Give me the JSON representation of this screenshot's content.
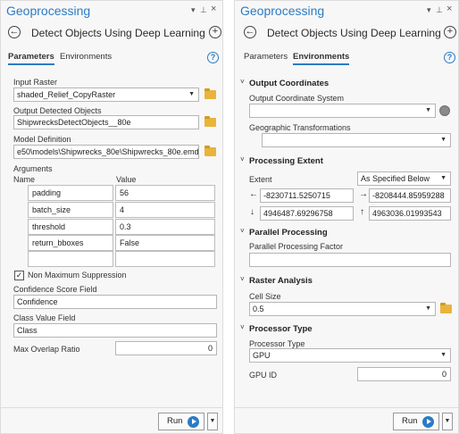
{
  "left": {
    "title": "Geoprocessing",
    "tool_name": "Detect Objects Using Deep Learning",
    "tabs": [
      "Parameters",
      "Environments"
    ],
    "input_raster_label": "Input Raster",
    "input_raster_value": "shaded_Relief_CopyRaster",
    "output_label": "Output Detected Objects",
    "output_value": "ShipwrecksDetectObjects__80e",
    "model_label": "Model Definition",
    "model_value": "e50\\models\\Shipwrecks_80e\\Shipwrecks_80e.emd",
    "arguments_label": "Arguments",
    "arg_col_name": "Name",
    "arg_col_value": "Value",
    "arguments": [
      {
        "name": "padding",
        "value": "56"
      },
      {
        "name": "batch_size",
        "value": "4"
      },
      {
        "name": "threshold",
        "value": "0.3"
      },
      {
        "name": "return_bboxes",
        "value": "False"
      }
    ],
    "nms_label": "Non Maximum Suppression",
    "nms_checked": true,
    "conf_label": "Confidence Score Field",
    "conf_value": "Confidence",
    "class_label": "Class Value Field",
    "class_value": "Class",
    "overlap_label": "Max Overlap Ratio",
    "overlap_value": "0",
    "run_label": "Run"
  },
  "right": {
    "title": "Geoprocessing",
    "tool_name": "Detect Objects Using Deep Learning",
    "tabs": [
      "Parameters",
      "Environments"
    ],
    "output_coords_section": "Output Coordinates",
    "ocs_label": "Output Coordinate System",
    "ocs_value": "",
    "geo_trans_label": "Geographic Transformations",
    "geo_trans_value": "",
    "processing_extent_section": "Processing Extent",
    "extent_label": "Extent",
    "extent_value": "As Specified Below",
    "extent_left": "-8230711.5250715",
    "extent_right": "-8208444.85959288",
    "extent_bottom": "4946487.69296758",
    "extent_top": "4963036.01993543",
    "parallel_section": "Parallel Processing",
    "ppf_label": "Parallel Processing Factor",
    "ppf_value": "",
    "raster_section": "Raster Analysis",
    "cellsize_label": "Cell Size",
    "cellsize_value": "0.5",
    "processor_section": "Processor Type",
    "proc_type_label": "Processor Type",
    "proc_type_value": "GPU",
    "gpu_id_label": "GPU ID",
    "gpu_id_value": "0",
    "run_label": "Run"
  },
  "icons": {
    "pin": "– ⁘ ×",
    "back": "←",
    "add": "+",
    "help": "?",
    "caret": "▼",
    "chevron": "˅",
    "check": "✓"
  }
}
